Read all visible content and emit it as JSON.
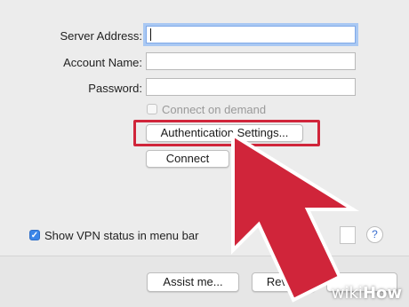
{
  "form": {
    "server_address_label": "Server Address:",
    "server_address_value": "",
    "account_name_label": "Account Name:",
    "account_name_value": "",
    "password_label": "Password:",
    "password_value": "",
    "connect_on_demand_label": "Connect on demand",
    "connect_on_demand_checked": false,
    "auth_settings_label": "Authentication Settings...",
    "connect_label": "Connect"
  },
  "status": {
    "show_vpn_status_label": "Show VPN status in menu bar",
    "show_vpn_status_checked": true,
    "help_label": "?"
  },
  "bottom_buttons": {
    "assist_label": "Assist me...",
    "revert_label": "Revert"
  },
  "annotation": {
    "highlight_color": "#d0253a",
    "arrow_color": "#d0253a"
  },
  "watermark": {
    "brand": "wikiHow",
    "prefix": "wiki",
    "suffix": "How"
  }
}
